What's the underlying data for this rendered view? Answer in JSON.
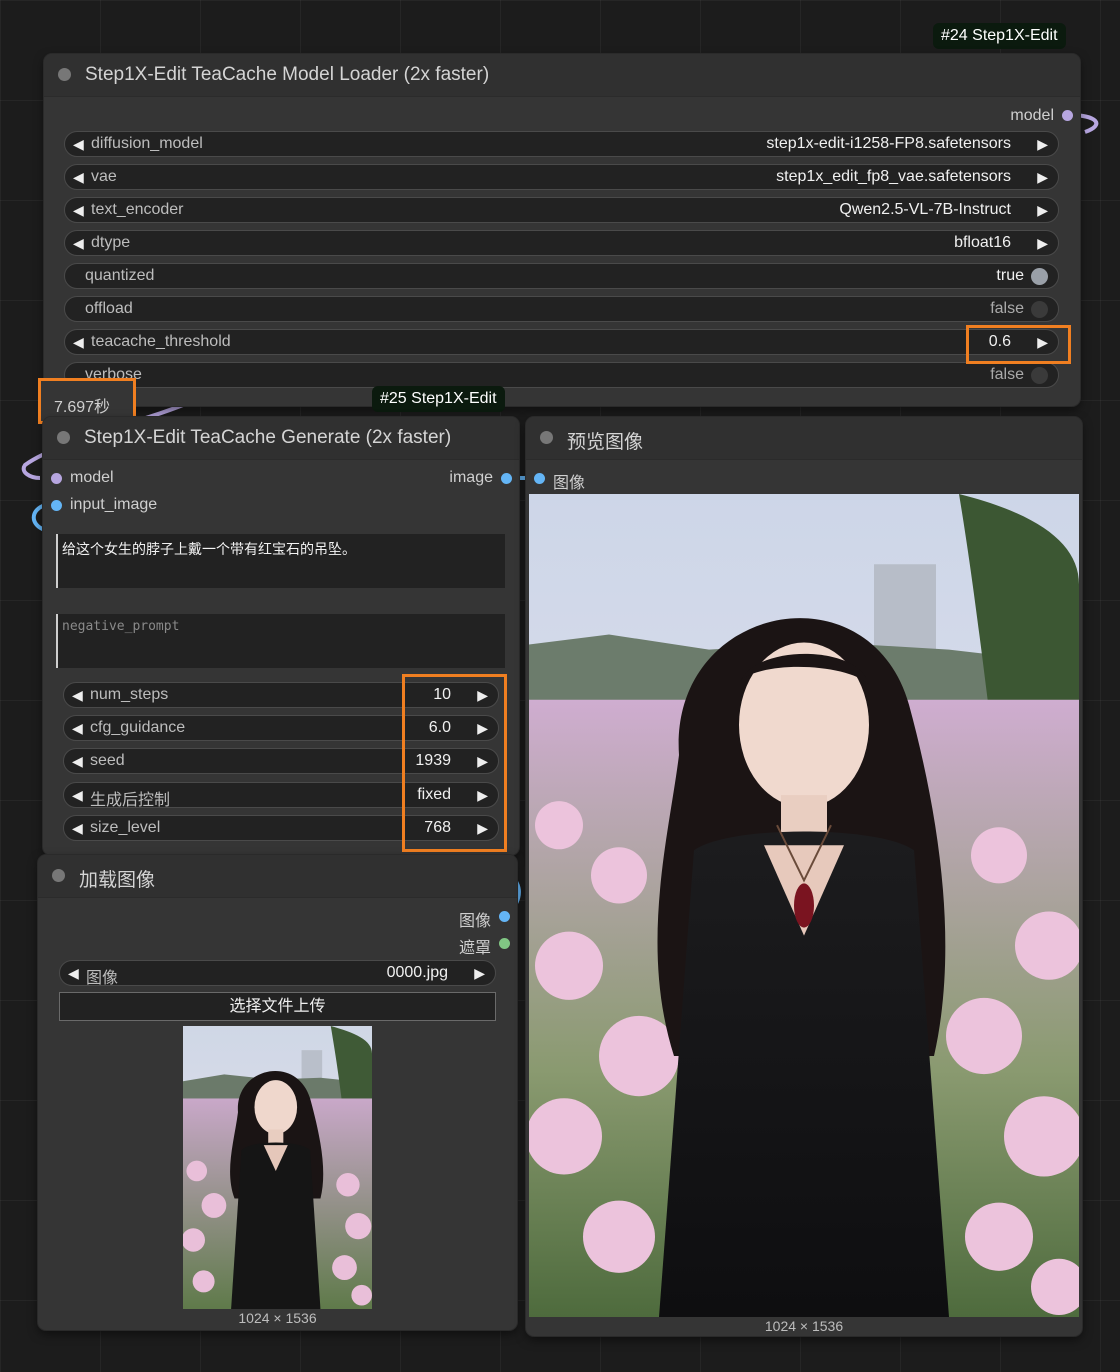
{
  "loader": {
    "badge": "#24 Step1X-Edit",
    "title": "Step1X-Edit TeaCache Model Loader (2x faster)",
    "output_model": "model",
    "widgets": {
      "diffusion_model": {
        "label": "diffusion_model",
        "value": "step1x-edit-i1258-FP8.safetensors"
      },
      "vae": {
        "label": "vae",
        "value": "step1x_edit_fp8_vae.safetensors"
      },
      "text_encoder": {
        "label": "text_encoder",
        "value": "Qwen2.5-VL-7B-Instruct"
      },
      "dtype": {
        "label": "dtype",
        "value": "bfloat16"
      },
      "quantized": {
        "label": "quantized",
        "value": "true"
      },
      "offload": {
        "label": "offload",
        "value": "false"
      },
      "teacache_threshold": {
        "label": "teacache_threshold",
        "value": "0.6"
      },
      "verbose": {
        "label": "verbose",
        "value": "false"
      }
    }
  },
  "timer": "7.697秒",
  "generate": {
    "badge": "#25 Step1X-Edit",
    "title": "Step1X-Edit TeaCache Generate (2x faster)",
    "inputs": {
      "model": "model",
      "input_image": "input_image"
    },
    "output_image": "image",
    "prompt": "给这个女生的脖子上戴一个带有红宝石的吊坠。",
    "negative_placeholder": "negative_prompt",
    "widgets": {
      "num_steps": {
        "label": "num_steps",
        "value": "10"
      },
      "cfg_guidance": {
        "label": "cfg_guidance",
        "value": "6.0"
      },
      "seed": {
        "label": "seed",
        "value": "1939"
      },
      "control_after_generate": {
        "label": "生成后控制",
        "value": "fixed"
      },
      "size_level": {
        "label": "size_level",
        "value": "768"
      }
    }
  },
  "preview": {
    "title": "预览图像",
    "input_image": "图像",
    "dimensions": "1024 × 1536"
  },
  "load_image": {
    "title": "加载图像",
    "outputs": {
      "image": "图像",
      "mask": "遮罩"
    },
    "image_widget": {
      "label": "图像",
      "value": "0000.jpg"
    },
    "upload_button": "选择文件上传",
    "dimensions": "1024 × 1536"
  },
  "colors": {
    "highlight": "#f07f21",
    "model_slot": "#b7a6e0",
    "image_slot": "#64b5f6",
    "mask_slot": "#81c784",
    "node_bg": "#353535"
  },
  "icons": [
    "arrow-left-icon",
    "arrow-right-icon",
    "node-status-icon",
    "toggle-icon",
    "woman-photo"
  ]
}
